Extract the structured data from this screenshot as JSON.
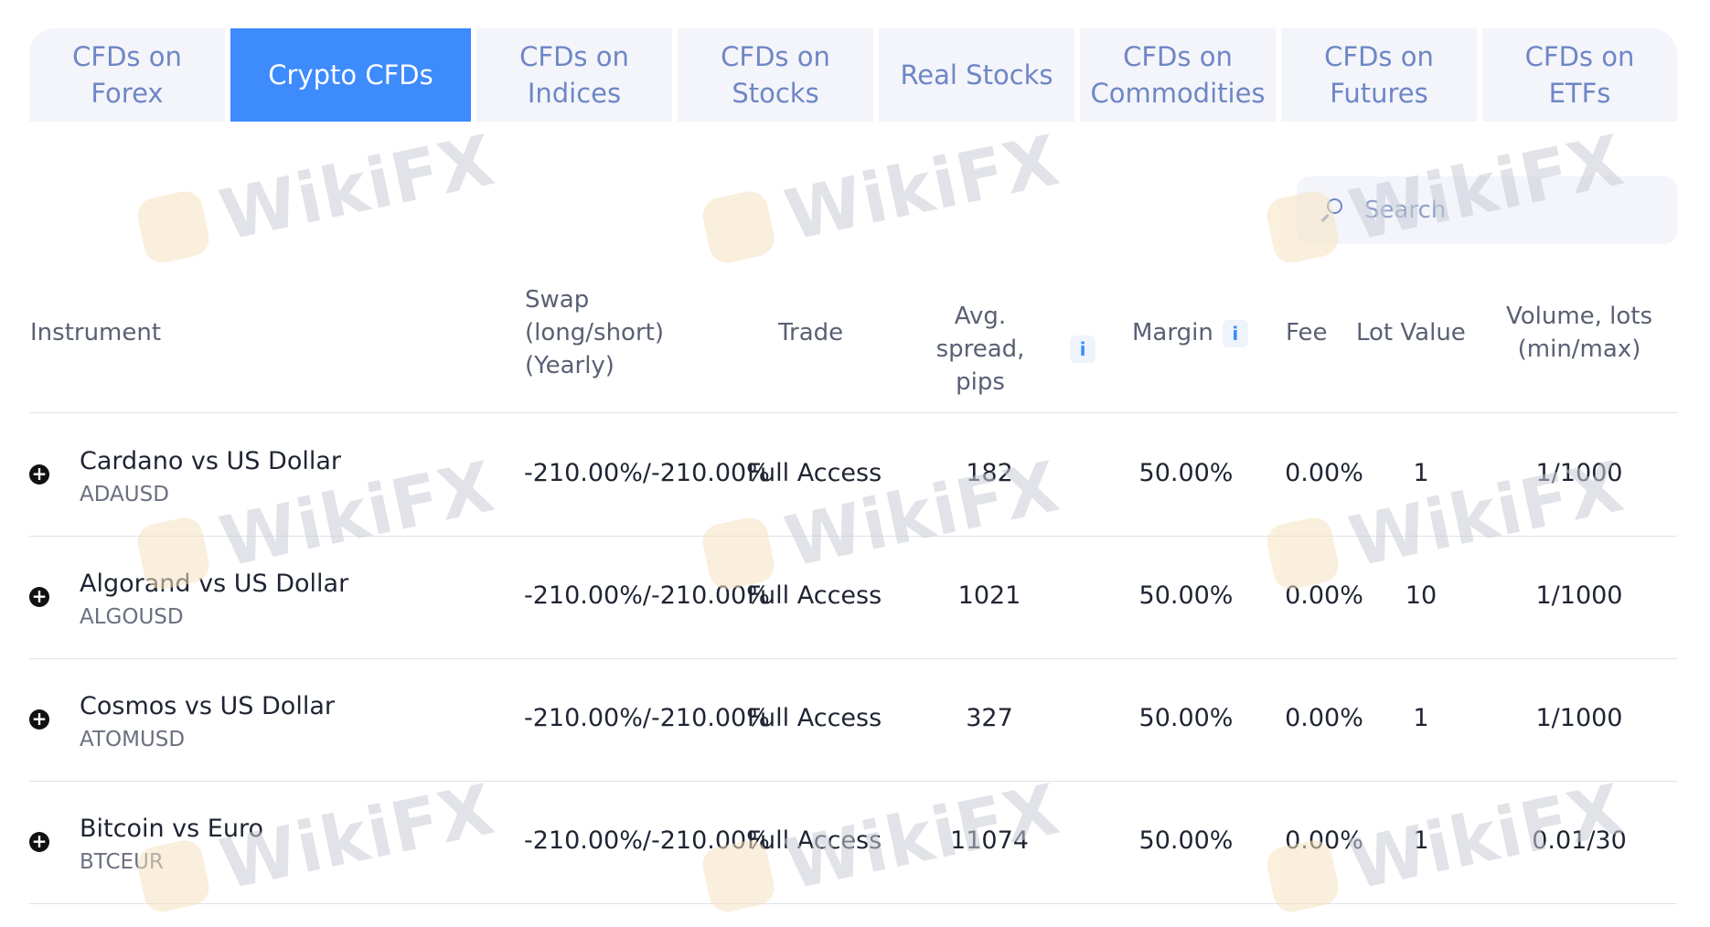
{
  "tabs": [
    {
      "label": "CFDs on\nForex",
      "active": false
    },
    {
      "label": "Crypto CFDs",
      "active": true
    },
    {
      "label": "CFDs on\nIndices",
      "active": false
    },
    {
      "label": "CFDs on\nStocks",
      "active": false
    },
    {
      "label": "Real Stocks",
      "active": false
    },
    {
      "label": "CFDs on\nCommodities",
      "active": false
    },
    {
      "label": "CFDs on\nFutures",
      "active": false
    },
    {
      "label": "CFDs on ETFs",
      "active": false
    }
  ],
  "search": {
    "placeholder": "Search",
    "icon": "search-icon"
  },
  "columns": {
    "instrument": "Instrument",
    "swap_line1": "Swap",
    "swap_line2": "(long/short)",
    "swap_line3": "(Yearly)",
    "trade": "Trade",
    "spread_line1": "Avg. spread,",
    "spread_line2": "pips",
    "margin": "Margin",
    "fee": "Fee",
    "lot_value": "Lot Value",
    "volume_line1": "Volume, lots",
    "volume_line2": "(min/max)",
    "info_glyph": "i"
  },
  "rows": [
    {
      "name": "Cardano vs US Dollar",
      "symbol": "ADAUSD",
      "swap": "-210.00%/-210.00%",
      "trade": "Full Access",
      "spread": "182",
      "margin": "50.00%",
      "fee": "0.00%",
      "lot_value": "1",
      "volume": "1/1000"
    },
    {
      "name": "Algorand vs US Dollar",
      "symbol": "ALGOUSD",
      "swap": "-210.00%/-210.00%",
      "trade": "Full Access",
      "spread": "1021",
      "margin": "50.00%",
      "fee": "0.00%",
      "lot_value": "10",
      "volume": "1/1000"
    },
    {
      "name": "Cosmos vs US Dollar",
      "symbol": "ATOMUSD",
      "swap": "-210.00%/-210.00%",
      "trade": "Full Access",
      "spread": "327",
      "margin": "50.00%",
      "fee": "0.00%",
      "lot_value": "1",
      "volume": "1/1000"
    },
    {
      "name": "Bitcoin vs Euro",
      "symbol": "BTCEUR",
      "swap": "-210.00%/-210.00%",
      "trade": "Full Access",
      "spread": "11074",
      "margin": "50.00%",
      "fee": "0.00%",
      "lot_value": "1",
      "volume": "0.01/30"
    }
  ],
  "expand_glyph": "+",
  "watermark": {
    "text": "WikiFX"
  },
  "colors": {
    "accent": "#3d8bfd",
    "tab_bg": "#f3f5fa",
    "tab_text": "#6f86c6"
  }
}
